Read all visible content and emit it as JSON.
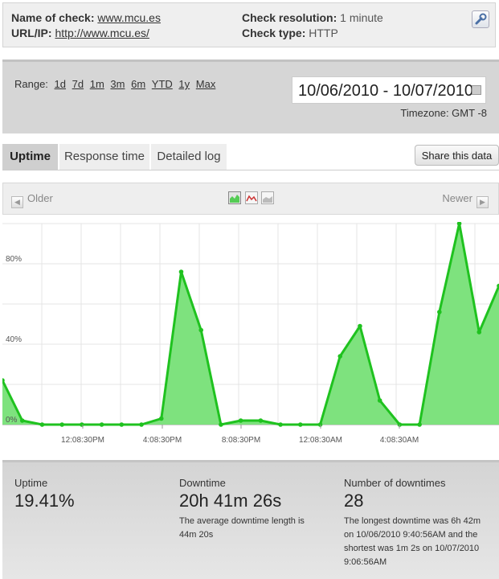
{
  "check": {
    "name_label": "Name of check:",
    "name_value": "www.mcu.es",
    "url_label": "URL/IP:",
    "url_value": "http://www.mcu.es/",
    "resolution_label": "Check resolution:",
    "resolution_value": "1 minute",
    "type_label": "Check type:",
    "type_value": "HTTP",
    "settings_icon": "wrench-icon"
  },
  "range": {
    "label": "Range:",
    "options": [
      "1d",
      "7d",
      "1m",
      "3m",
      "6m",
      "YTD",
      "1y",
      "Max"
    ],
    "date_range": "10/06/2010 - 10/07/2010",
    "timezone": "Timezone: GMT -8"
  },
  "tabs": [
    "Uptime",
    "Response time",
    "Detailed log"
  ],
  "share_label": "Share this data",
  "nav": {
    "older": "Older",
    "newer": "Newer",
    "chart_types": [
      "area-chart-icon",
      "line-chart-icon",
      "bar-chart-icon"
    ]
  },
  "chart_data": {
    "type": "area",
    "color": "#1fc21f",
    "fill": "#7ee27e",
    "yticks": [
      "0%",
      "40%",
      "80%"
    ],
    "ylim": [
      0,
      100
    ],
    "xticks": [
      "12:08:30PM",
      "4:08:30PM",
      "8:08:30PM",
      "12:08:30AM",
      "4:08:30AM"
    ],
    "values": [
      22,
      2,
      0,
      0,
      0,
      0,
      0,
      0,
      3,
      76,
      47,
      0,
      2,
      2,
      0,
      0,
      0,
      34,
      49,
      12,
      0,
      0,
      56,
      100,
      46,
      69
    ]
  },
  "stats": {
    "uptime_label": "Uptime",
    "uptime_value": "19.41%",
    "downtime_label": "Downtime",
    "downtime_value": "20h 41m 26s",
    "downtime_desc": "The average downtime length is 44m 20s",
    "downtimes_label": "Number of downtimes",
    "downtimes_value": "28",
    "downtimes_desc": "The longest downtime was 6h 42m on 10/06/2010 9:40:56AM and the shortest was 1m 2s on 10/07/2010 9:06:56AM"
  }
}
